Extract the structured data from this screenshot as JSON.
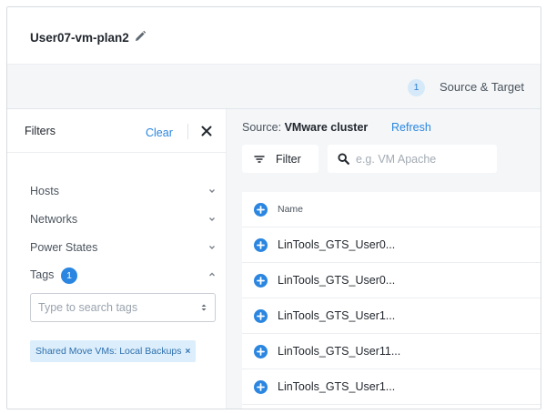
{
  "plan": {
    "name": "User07-vm-plan2",
    "edit_icon": "pencil-icon"
  },
  "steps": {
    "number": "1",
    "label": "Source & Target"
  },
  "filters": {
    "title": "Filters",
    "clear_label": "Clear",
    "close_icon": "close-icon",
    "facets": [
      {
        "label": "Hosts",
        "expanded": false
      },
      {
        "label": "Networks",
        "expanded": false
      },
      {
        "label": "Power States",
        "expanded": false
      },
      {
        "label": "Tags",
        "expanded": true,
        "count": "1"
      }
    ],
    "tag_search_placeholder": "Type to search tags",
    "selected_tag": "Shared Move VMs: Local Backups",
    "selected_tag_remove": "×"
  },
  "source": {
    "prefix": "Source: ",
    "name": "VMware cluster",
    "refresh_label": "Refresh",
    "filter_button_label": "Filter",
    "search_placeholder": "e.g. VM Apache",
    "table": {
      "column_header": "Name",
      "rows": [
        {
          "name": "LinTools_GTS_User0..."
        },
        {
          "name": "LinTools_GTS_User0..."
        },
        {
          "name": "LinTools_GTS_User1..."
        },
        {
          "name": "LinTools_GTS_User11..."
        },
        {
          "name": "LinTools_GTS_User1..."
        }
      ]
    }
  },
  "colors": {
    "accent": "#2a86e0",
    "chip_bg": "#dceefb",
    "panel_bg": "#f4f6f8"
  }
}
